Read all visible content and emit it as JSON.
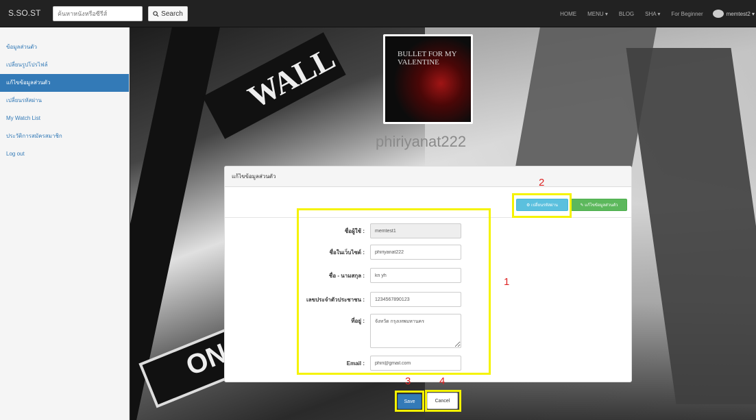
{
  "navbar": {
    "brand": "S.SO.ST",
    "search_placeholder": "ค้นหาหนังหรือซีรีส์",
    "search_button": "Search",
    "links": [
      "HOME",
      "MENU ▾",
      "BLOG",
      "SHA ▾",
      "For Beginner"
    ],
    "user": "memtest2 ▾"
  },
  "sidebar": {
    "items": [
      {
        "label": "ข้อมูลส่วนตัว"
      },
      {
        "label": "เปลี่ยนรูปโปรไฟล์"
      },
      {
        "label": "แก้ไขข้อมูลส่วนตัว"
      },
      {
        "label": "เปลี่ยนรหัสผ่าน"
      },
      {
        "label": "My Watch List"
      },
      {
        "label": "ประวัติการสมัครสมาชิก"
      },
      {
        "label": "Log out"
      }
    ],
    "active_index": 2
  },
  "scene": {
    "wall_sign": "WALL",
    "one_sign": "ON"
  },
  "profile": {
    "avatar_text": "BULLET FOR MY VALENTINE",
    "username": "phiriyanat222"
  },
  "panel": {
    "title": "แก้ไขข้อมูลส่วนตัว",
    "btn_change_password": "เปลี่ยนรหัสผ่าน",
    "btn_edit_info": "แก้ไขข้อมูลส่วนตัว",
    "fields": [
      {
        "label": "ชื่อผู้ใช้ :",
        "value": "memtest1"
      },
      {
        "label": "ชื่อในเว็บไซต์ :",
        "value": "phiriyanat222"
      },
      {
        "label": "ชื่อ - นามสกุล :",
        "value": "kn yh"
      },
      {
        "label": "เลขประจำตัวประชาชน :",
        "value": "1234567890123"
      },
      {
        "label": "ที่อยู่ :",
        "value": "จังหวัด กรุงเทพมหานคร"
      },
      {
        "label": "Email :",
        "value": "phiri@gmail.com"
      }
    ]
  },
  "buttons": {
    "save": "Save",
    "cancel": "Cancel"
  },
  "annotations": {
    "n1": "1",
    "n2": "2",
    "n3": "3",
    "n4": "4"
  },
  "colors": {
    "primary": "#337ab7",
    "info": "#5bc0de",
    "success": "#5cb85c",
    "highlight": "#f5f300",
    "annotation_number": "#dd2222"
  }
}
